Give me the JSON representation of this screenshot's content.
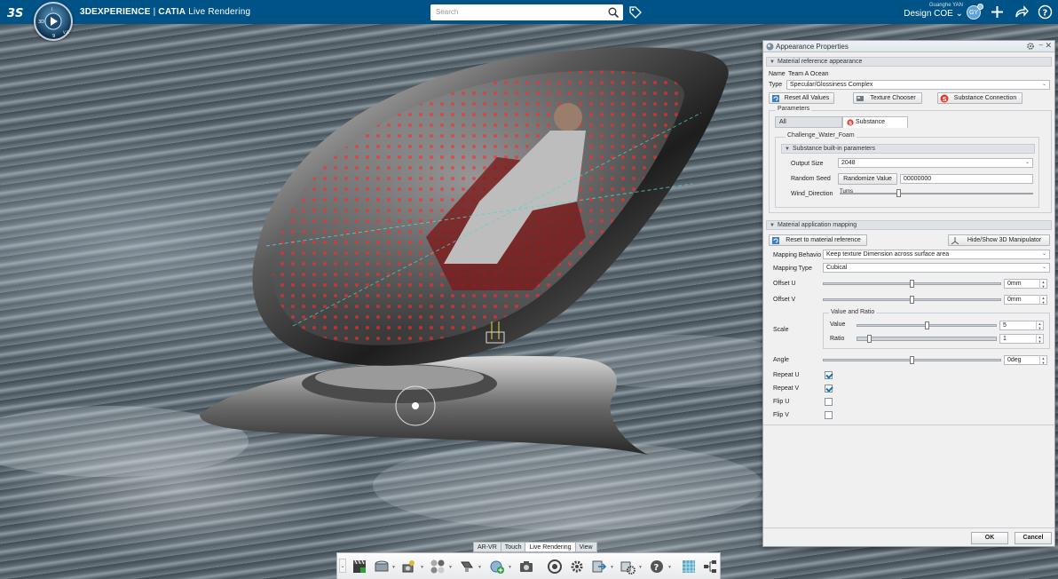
{
  "app": {
    "brand_bold": "3DEXPERIENCE",
    "brand_sep": " | ",
    "brand_catia": "CATIA",
    "brand_module": " Live Rendering",
    "compass_n": "i",
    "compass_w": "3D",
    "compass_s": "9",
    "compass_e": "V,R"
  },
  "search": {
    "placeholder": "Search"
  },
  "user": {
    "name": "Guanghe YAN",
    "workspace": "Design COE",
    "initials": "GY"
  },
  "panel": {
    "title": "Appearance Properties",
    "material_section": "Material reference appearance",
    "name_label": "Name",
    "name_value": "Team A Ocean",
    "type_label": "Type",
    "type_value": "Specular/Glossiness Complex",
    "btn_reset_all": "Reset All Values",
    "btn_texture": "Texture Chooser",
    "btn_substance": "Substance Connection",
    "parameters_label": "Parameters",
    "tab_all": "All",
    "tab_substance": "Substance",
    "substance_group": "Challenge_Water_Foam",
    "builtin_section": "Substance built-in parameters",
    "output_size_label": "Output Size",
    "output_size_value": "2048",
    "random_seed_label": "Random Seed",
    "randomize_btn": "Randomize Value",
    "random_seed_value": "00000000",
    "wind_label": "Wind_Direction",
    "wind_unit": "Turns",
    "wind_level": 0.3,
    "mapping_section": "Material application mapping",
    "btn_reset_ref": "Reset to material reference",
    "btn_manip": "Hide/Show 3D Manipulator",
    "mapping_behavior_label": "Mapping Behavio",
    "mapping_behavior_value": "Keep texture Dimension across surface area",
    "mapping_type_label": "Mapping Type",
    "mapping_type_value": "Cubical",
    "offset_u_label": "Offset U",
    "offset_u_value": "0mm",
    "offset_u_level": 0.5,
    "offset_v_label": "Offset V",
    "offset_v_value": "0mm",
    "offset_v_level": 0.5,
    "scale_label": "Scale",
    "value_ratio_label": "Value and Ratio",
    "value_label": "Value",
    "value_value": "5",
    "value_level": 0.5,
    "ratio_label": "Ratio",
    "ratio_value": "1",
    "ratio_level": 0.08,
    "angle_label": "Angle",
    "angle_value": "0deg",
    "angle_level": 0.5,
    "repeat_u_label": "Repeat U",
    "repeat_u": true,
    "repeat_v_label": "Repeat V",
    "repeat_v": true,
    "flip_u_label": "Flip U",
    "flip_u": false,
    "flip_v_label": "Flip V",
    "flip_v": false,
    "ok": "OK",
    "cancel": "Cancel"
  },
  "bottom_tabs": [
    {
      "label": "AR-VR",
      "active": false
    },
    {
      "label": "Touch",
      "active": false
    },
    {
      "label": "Live Rendering",
      "active": true
    },
    {
      "label": "View",
      "active": false
    }
  ],
  "action_bar_icons": [
    "clapboard-icon",
    "environment-icon",
    "camera-scene-icon",
    "materials-icon",
    "light-icon",
    "add-stage-icon",
    "capture-icon",
    "render-icon",
    "settings-icon",
    "import-icon",
    "tools-icon",
    "help-icon",
    "texture-icon",
    "network-icon"
  ],
  "colors": {
    "topbar": "#005386",
    "accent": "#1b6fb3"
  }
}
